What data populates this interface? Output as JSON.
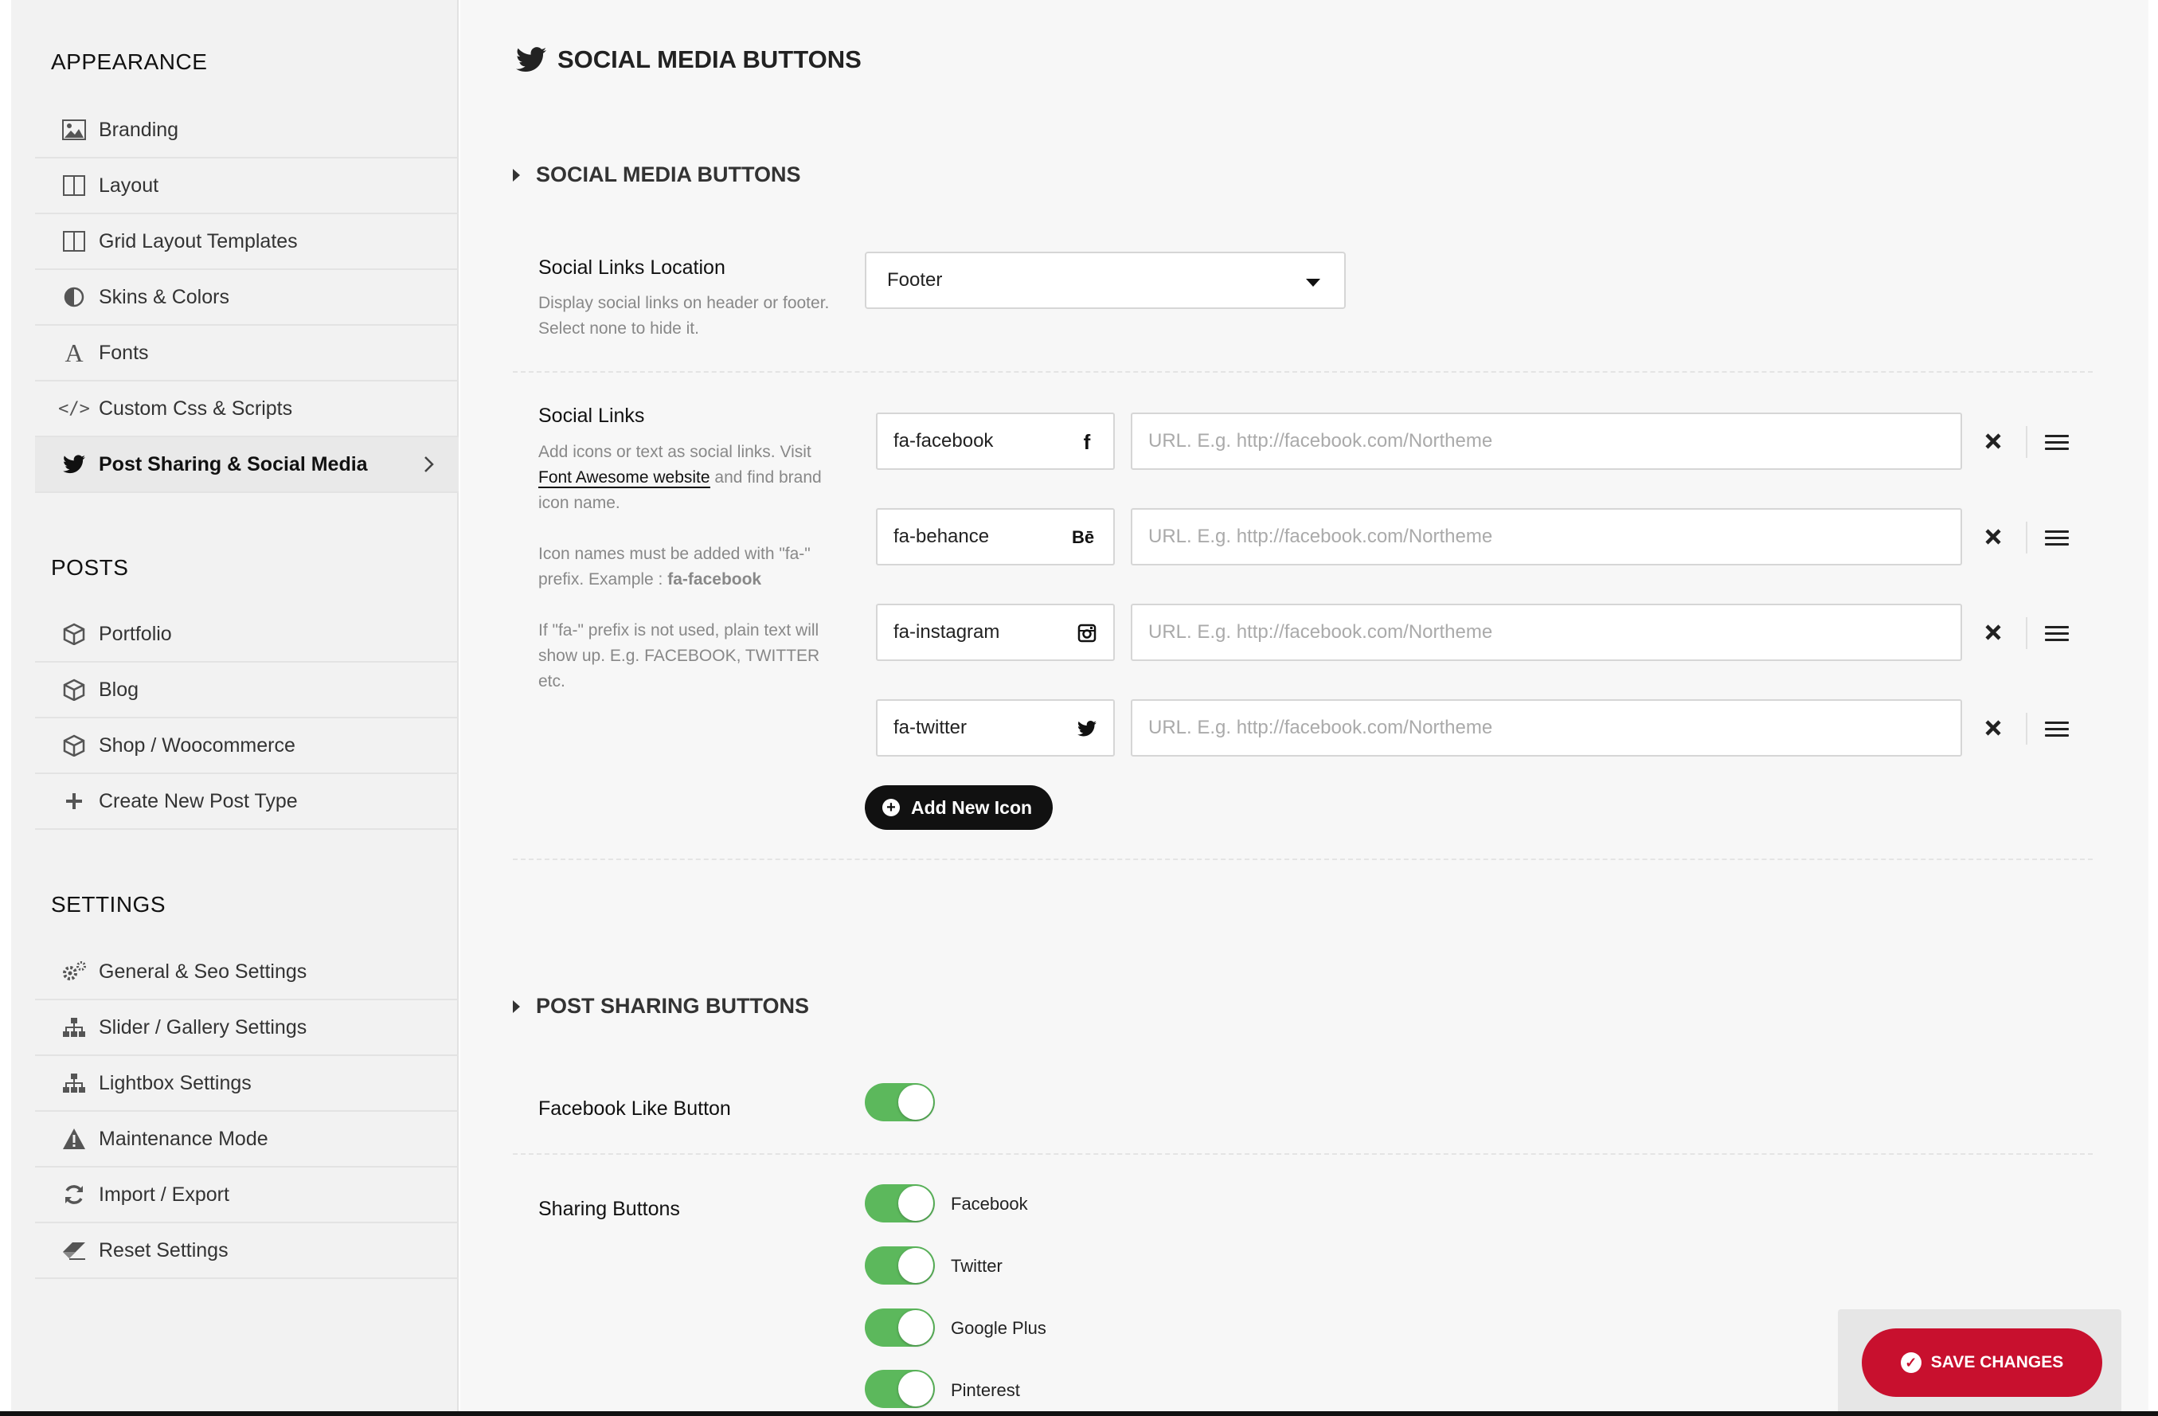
{
  "sidebar": {
    "appearance_heading": "APPEARANCE",
    "posts_heading": "POSTS",
    "settings_heading": "SETTINGS",
    "appearance_items": [
      {
        "label": "Branding",
        "icon": "image-icon"
      },
      {
        "label": "Layout",
        "icon": "columns-icon"
      },
      {
        "label": "Grid Layout Templates",
        "icon": "columns-icon"
      },
      {
        "label": "Skins & Colors",
        "icon": "adjust-icon"
      },
      {
        "label": "Fonts",
        "icon": "font-icon"
      },
      {
        "label": "Custom Css & Scripts",
        "icon": "code-icon"
      },
      {
        "label": "Post Sharing & Social Media",
        "icon": "twitter-icon",
        "active": true
      }
    ],
    "posts_items": [
      {
        "label": "Portfolio",
        "icon": "cube-icon"
      },
      {
        "label": "Blog",
        "icon": "cube-icon"
      },
      {
        "label": "Shop / Woocommerce",
        "icon": "cube-icon"
      },
      {
        "label": "Create New Post Type",
        "icon": "plus-icon"
      }
    ],
    "settings_items": [
      {
        "label": "General & Seo Settings",
        "icon": "gears-icon"
      },
      {
        "label": "Slider / Gallery Settings",
        "icon": "sitemap-icon"
      },
      {
        "label": "Lightbox Settings",
        "icon": "sitemap-icon"
      },
      {
        "label": "Maintenance Mode",
        "icon": "warning-icon"
      },
      {
        "label": "Import / Export",
        "icon": "refresh-icon"
      },
      {
        "label": "Reset Settings",
        "icon": "eraser-icon"
      }
    ]
  },
  "main": {
    "page_title": "SOCIAL MEDIA BUTTONS",
    "social_section_title": "SOCIAL MEDIA BUTTONS",
    "location": {
      "label": "Social Links Location",
      "desc": "Display social links on header or footer. Select none to hide it.",
      "value": "Footer"
    },
    "links": {
      "label": "Social Links",
      "desc1_pre": "Add icons or text as social links. Visit",
      "desc1_link": "Font Awesome website",
      "desc1_post": "and find brand icon name.",
      "desc2_pre": "Icon names must be added with \"fa-\" prefix. Example :",
      "desc2_bold": "fa-facebook",
      "desc3": "If \"fa-\" prefix is not used, plain text will show up. E.g. FACEBOOK, TWITTER etc.",
      "url_placeholder": "URL. E.g. http://facebook.com/Northeme",
      "items": [
        {
          "icon_name": "fa-facebook",
          "glyph": "f"
        },
        {
          "icon_name": "fa-behance",
          "glyph": "Bē"
        },
        {
          "icon_name": "fa-instagram",
          "glyph": "◙"
        },
        {
          "icon_name": "fa-twitter",
          "glyph": "twitter"
        }
      ],
      "add_label": "Add New Icon"
    },
    "sharing_section_title": "POST SHARING BUTTONS",
    "fb_like": {
      "label": "Facebook Like Button",
      "on": true
    },
    "sharing": {
      "label": "Sharing Buttons",
      "options": [
        {
          "label": "Facebook",
          "on": true
        },
        {
          "label": "Twitter",
          "on": true
        },
        {
          "label": "Google Plus",
          "on": true
        },
        {
          "label": "Pinterest",
          "on": true
        }
      ]
    },
    "save_label": "SAVE CHANGES"
  },
  "colors": {
    "toggle_on": "#5cb85c",
    "save_button": "#c8102e",
    "add_button": "#111111"
  }
}
